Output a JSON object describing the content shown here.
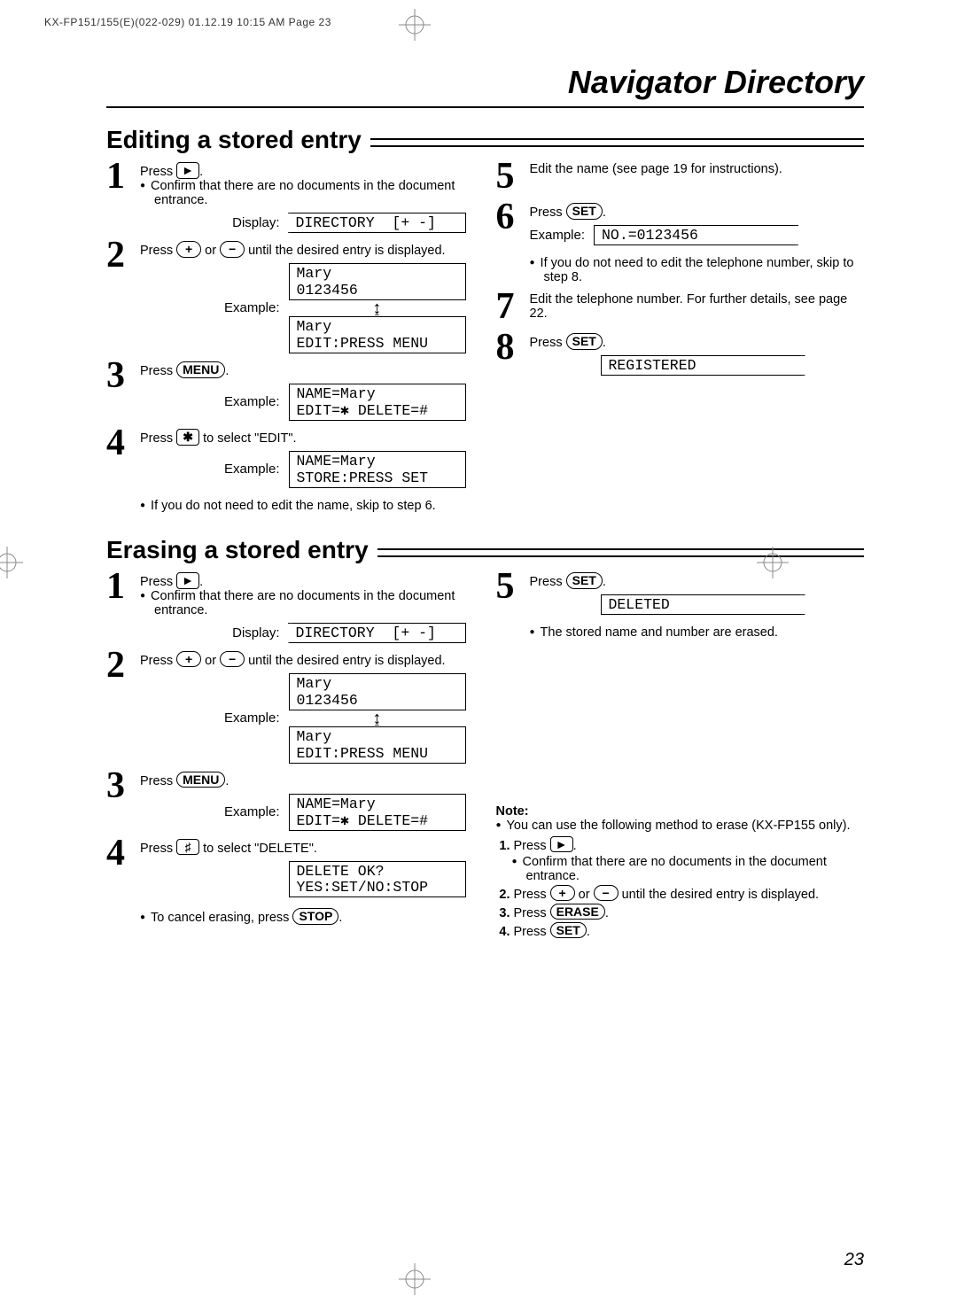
{
  "header_code": "KX-FP151/155(E)(022-029)  01.12.19 10:15 AM  Page 23",
  "title": "Navigator Directory",
  "page_number": "23",
  "edit_section_title": "Editing a stored entry",
  "erase_section_title": "Erasing a stored entry",
  "labels": {
    "display": "Display:",
    "example": "Example:",
    "note": "Note:",
    "press": "Press",
    "or": " or ",
    "until_desired": " until the desired entry is displayed.",
    "confirm_no_docs": "Confirm that there are no documents in the document entrance.",
    "confirm_no_docs_short": "Confirm that there are no documents in the  document entrance."
  },
  "lcd": {
    "directory": "DIRECTORY  [+ -]",
    "mary_num": "Mary\n0123456",
    "mary_edit": "Mary\nEDIT:PRESS MENU",
    "name_mary_edit_delete": "NAME=Mary\nEDIT=✱ DELETE=#",
    "name_mary_store": "NAME=Mary\nSTORE:PRESS SET",
    "no_number": "NO.=0123456",
    "registered": "REGISTERED",
    "delete_ok": "DELETE OK?\nYES:SET/NO:STOP",
    "deleted": "DELETED"
  },
  "keys": {
    "play": "►",
    "plus": "+",
    "minus": "−",
    "menu": "MENU",
    "asterisk": "✱",
    "hash": "♯",
    "set": "SET",
    "stop": "STOP",
    "erase": "ERASE"
  },
  "edit": {
    "step4_text": " to select \"EDIT\".",
    "step4_note": "If you do not need to edit the name, skip to step 6.",
    "step5": "Edit the name (see page 19 for instructions).",
    "step6_note": "If you do not need to edit the telephone number, skip to step 8.",
    "step7": "Edit the telephone number. For further details, see page 22."
  },
  "erase": {
    "step4_text": " to select \"DELETE\".",
    "step4_note": "To cancel erasing, press ",
    "step5_note": "The stored name and number are erased.",
    "note_intro": "You can use the following method to erase (KX-FP155 only)."
  }
}
